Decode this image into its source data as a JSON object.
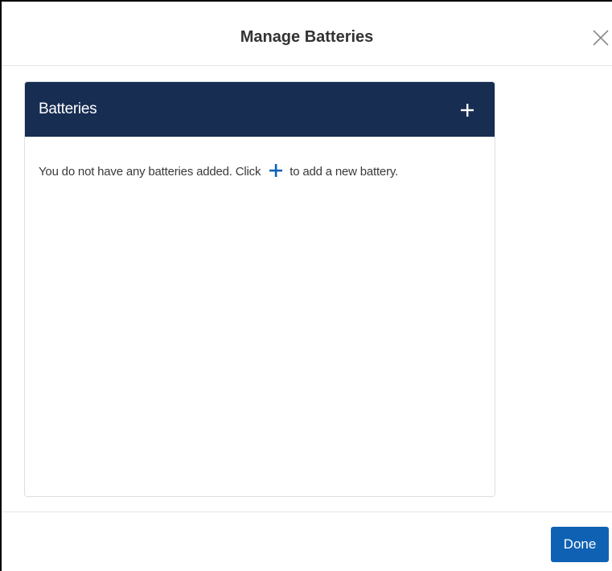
{
  "dialog": {
    "title": "Manage Batteries",
    "close_icon": "close-icon"
  },
  "panel": {
    "title": "Batteries",
    "add_icon": "plus-icon",
    "empty_message_before": "You do not have any batteries added. Click",
    "empty_message_after": "to add a new battery."
  },
  "footer": {
    "done_label": "Done"
  },
  "colors": {
    "panel_header_bg": "#172d52",
    "accent_blue": "#0f62b3",
    "text_dark": "#333333"
  }
}
